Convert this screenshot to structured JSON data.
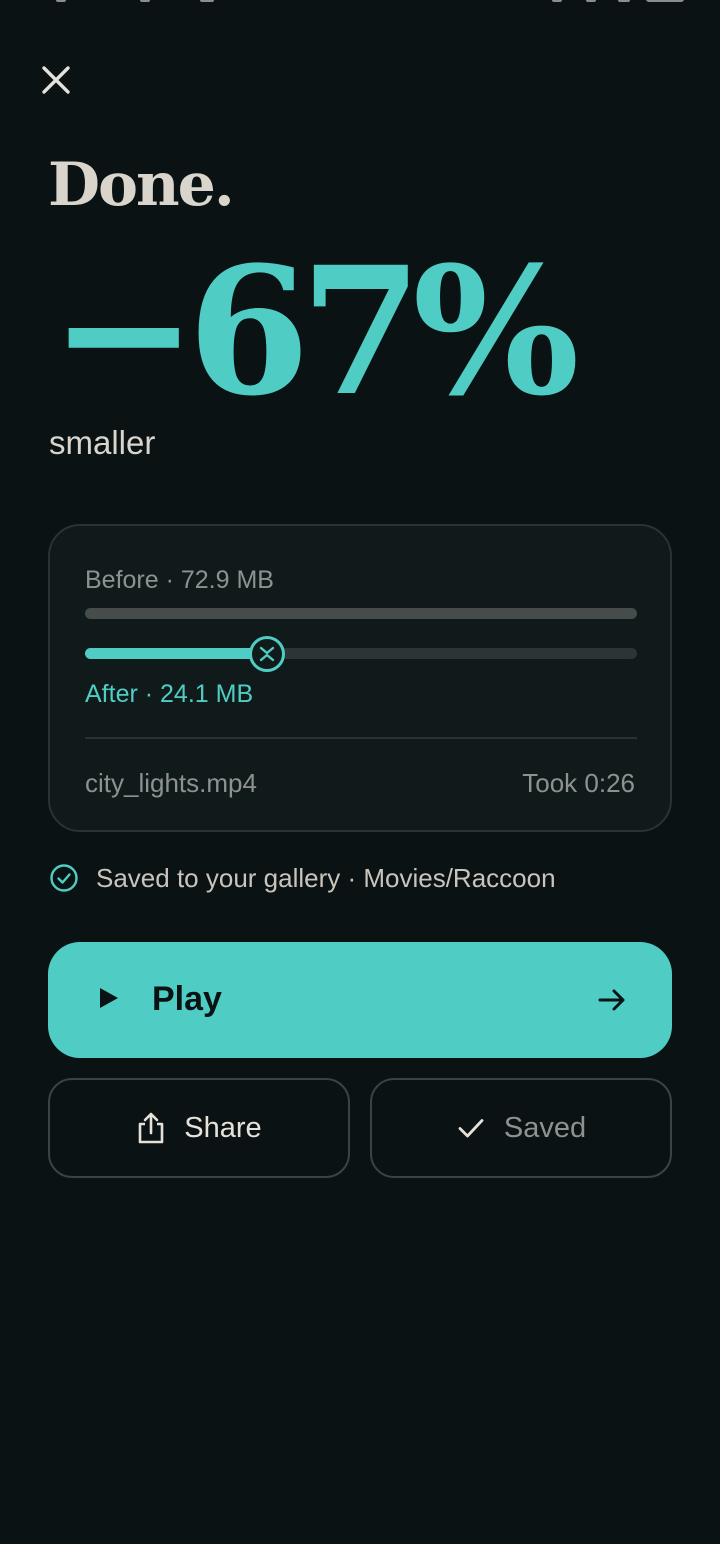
{
  "header": {
    "title": "Done."
  },
  "result": {
    "reduction": "−67%",
    "reduction_caption": "smaller"
  },
  "stats": {
    "before_label": "Before · 72.9 MB",
    "after_label": "After · 24.1 MB",
    "before_mb": 72.9,
    "after_mb": 24.1,
    "file_name": "city_lights.mp4",
    "duration": "Took 0:26"
  },
  "saved_status": {
    "text": "Saved to your gallery · Movies/Raccoon"
  },
  "actions": {
    "play_label": "Play",
    "share_label": "Share",
    "saved_label": "Saved"
  },
  "colors": {
    "accent": "#4fcdc4",
    "background": "#0a1213",
    "card": "#111a1b"
  },
  "icons": {
    "close": "close-icon",
    "play": "play-icon",
    "arrow": "arrow-right-icon",
    "share": "share-icon",
    "check": "check-icon",
    "check_circle": "check-circle-icon",
    "compress": "compress-icon"
  }
}
